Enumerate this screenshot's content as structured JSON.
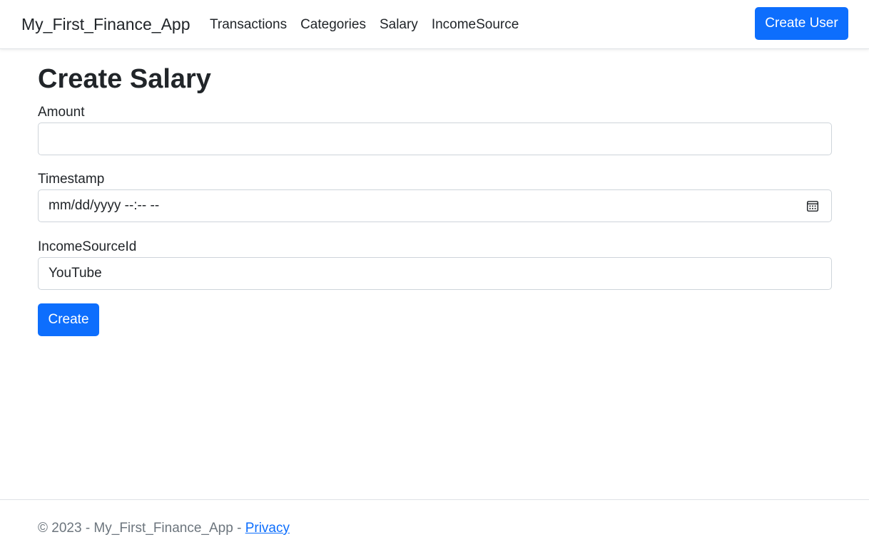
{
  "navbar": {
    "brand": "My_First_Finance_App",
    "links": [
      "Transactions",
      "Categories",
      "Salary",
      "IncomeSource"
    ],
    "create_user_label": "Create User"
  },
  "form": {
    "title": "Create Salary",
    "amount": {
      "label": "Amount",
      "value": ""
    },
    "timestamp": {
      "label": "Timestamp",
      "placeholder": "mm/dd/yyyy --:-- --",
      "icon": "calendar-icon"
    },
    "income_source": {
      "label": "IncomeSourceId",
      "selected": "YouTube"
    },
    "submit_label": "Create"
  },
  "footer": {
    "text": "© 2023 - My_First_Finance_App - ",
    "link": "Privacy"
  },
  "colors": {
    "primary": "#0d6efd",
    "text": "#212529",
    "muted": "#6c757d",
    "border": "#ced4da"
  }
}
